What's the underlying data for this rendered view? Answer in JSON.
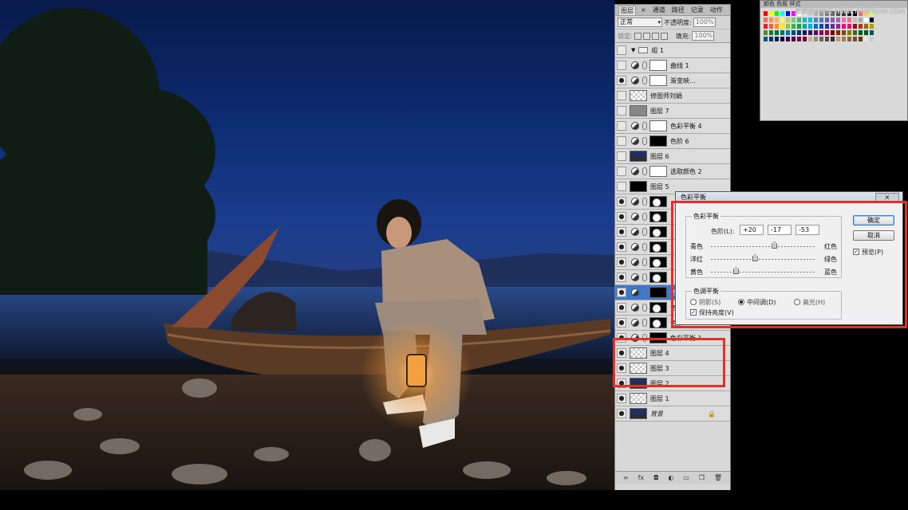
{
  "layers_panel": {
    "tabs": [
      "图层",
      "通道",
      "路径",
      "记录",
      "动作"
    ],
    "tab_close": "×",
    "blend_mode": "正常",
    "opacity_label": "不透明度:",
    "opacity": "100%",
    "lock_label": "锁定:",
    "fill_label": "填充:",
    "fill": "100%",
    "layers": [
      {
        "name": "组 1",
        "kind": "group"
      },
      {
        "name": "曲线 1",
        "kind": "adj"
      },
      {
        "name": "渐变映...",
        "kind": "adj"
      },
      {
        "name": "修图师刘娟",
        "kind": "text"
      },
      {
        "name": "图层 7",
        "kind": "pixel"
      },
      {
        "name": "色彩平衡 4",
        "kind": "adj"
      },
      {
        "name": "色阶 6",
        "kind": "adj"
      },
      {
        "name": "图层 6",
        "kind": "pixel"
      },
      {
        "name": "选取颜色 2",
        "kind": "adj"
      },
      {
        "name": "图层 5",
        "kind": "pixel"
      },
      {
        "name": "",
        "kind": "adj"
      },
      {
        "name": "",
        "kind": "adj"
      },
      {
        "name": "",
        "kind": "adj"
      },
      {
        "name": "",
        "kind": "adj"
      },
      {
        "name": "",
        "kind": "adj"
      },
      {
        "name": "",
        "kind": "adj"
      },
      {
        "name": "色彩平衡 2",
        "kind": "adj"
      },
      {
        "name": "色阶 2",
        "kind": "adj"
      },
      {
        "name": "色阶 1",
        "kind": "adj"
      },
      {
        "name": "色彩平衡 1",
        "kind": "adj"
      },
      {
        "name": "图层 4",
        "kind": "pixel"
      },
      {
        "name": "图层 3",
        "kind": "pixel"
      },
      {
        "name": "图层 2",
        "kind": "pixel"
      },
      {
        "name": "图层 1",
        "kind": "pixel"
      },
      {
        "name": "背景",
        "kind": "bg"
      }
    ],
    "footer_icons": [
      "link-icon",
      "fx-icon",
      "mask-icon",
      "adjustment-icon",
      "folder-icon",
      "new-layer-icon",
      "trash-icon"
    ],
    "footer_glyphs": [
      "∞",
      "fx",
      "◘",
      "◐",
      "▭",
      "❐",
      "🗑"
    ]
  },
  "swatches": {
    "tabs": "颜色 色板 样式",
    "watermark": "思缘设计论坛 WWW.MISSYUAN.COM",
    "colors": [
      "#ff0000",
      "#ffff00",
      "#00ff00",
      "#00ffff",
      "#0000ff",
      "#ff00ff",
      "#ffffff",
      "#e6e6e6",
      "#cccccc",
      "#b3b3b3",
      "#999999",
      "#808080",
      "#666666",
      "#4d4d4d",
      "#333333",
      "#1a1a1a",
      "#000000",
      "#ff6666",
      "#ffcc66",
      "#ccff66",
      "#f26c4f",
      "#f68e55",
      "#fbaf5c",
      "#fff467",
      "#acd372",
      "#7cc576",
      "#3bb878",
      "#1abbb4",
      "#00bff3",
      "#438ccb",
      "#5574b9",
      "#605ca8",
      "#855fa8",
      "#a763a8",
      "#f06ea9",
      "#f26d7d",
      "#c0c0c0",
      "#aaaaaa",
      "#ffffff",
      "#000000",
      "#ed1c24",
      "#f26522",
      "#f7941d",
      "#fff200",
      "#8dc63f",
      "#39b54a",
      "#00a651",
      "#00a99d",
      "#00aeef",
      "#0072bc",
      "#0054a6",
      "#2e3192",
      "#662d91",
      "#92278f",
      "#ec008c",
      "#ed145b",
      "#9e0b0f",
      "#a0410d",
      "#a3620a",
      "#aba000",
      "#598527",
      "#197b30",
      "#007236",
      "#00746b",
      "#0076a3",
      "#004b80",
      "#003471",
      "#1b1464",
      "#440e62",
      "#630460",
      "#9e005d",
      "#9e0039",
      "#790000",
      "#7b2e00",
      "#7d4900",
      "#827b00",
      "#406618",
      "#005e20",
      "#005826",
      "#005952",
      "#005b7f",
      "#003663",
      "#002157",
      "#0d004c",
      "#32004b",
      "#4b0049",
      "#7b0046",
      "#7a0026",
      "#c7b299",
      "#998675",
      "#736357",
      "#534741",
      "#37302d",
      "#c69c6d",
      "#a67c52",
      "#8c6239",
      "#754c24",
      "#603913",
      "#e6e6e6",
      "#cccccc"
    ]
  },
  "dialog": {
    "title": "色彩平衡",
    "close": "×",
    "balance_group": "色彩平衡",
    "levels_label": "色阶(L):",
    "levels": [
      "+20",
      "-17",
      "-53"
    ],
    "sliders": [
      {
        "left": "青色",
        "right": "红色",
        "value": 20
      },
      {
        "left": "洋红",
        "right": "绿色",
        "value": -17
      },
      {
        "left": "黄色",
        "right": "蓝色",
        "value": -53
      }
    ],
    "tone_group": "色调平衡",
    "tones": [
      "阴影(S)",
      "中间调(D)",
      "高光(H)"
    ],
    "selected_tone": "中间调(D)",
    "preserve": "保持亮度(V)",
    "preserve_checked": true,
    "ok": "确定",
    "cancel": "取消",
    "preview": "预览(P)",
    "preview_checked": true
  },
  "highlight_color": "#e0302a"
}
